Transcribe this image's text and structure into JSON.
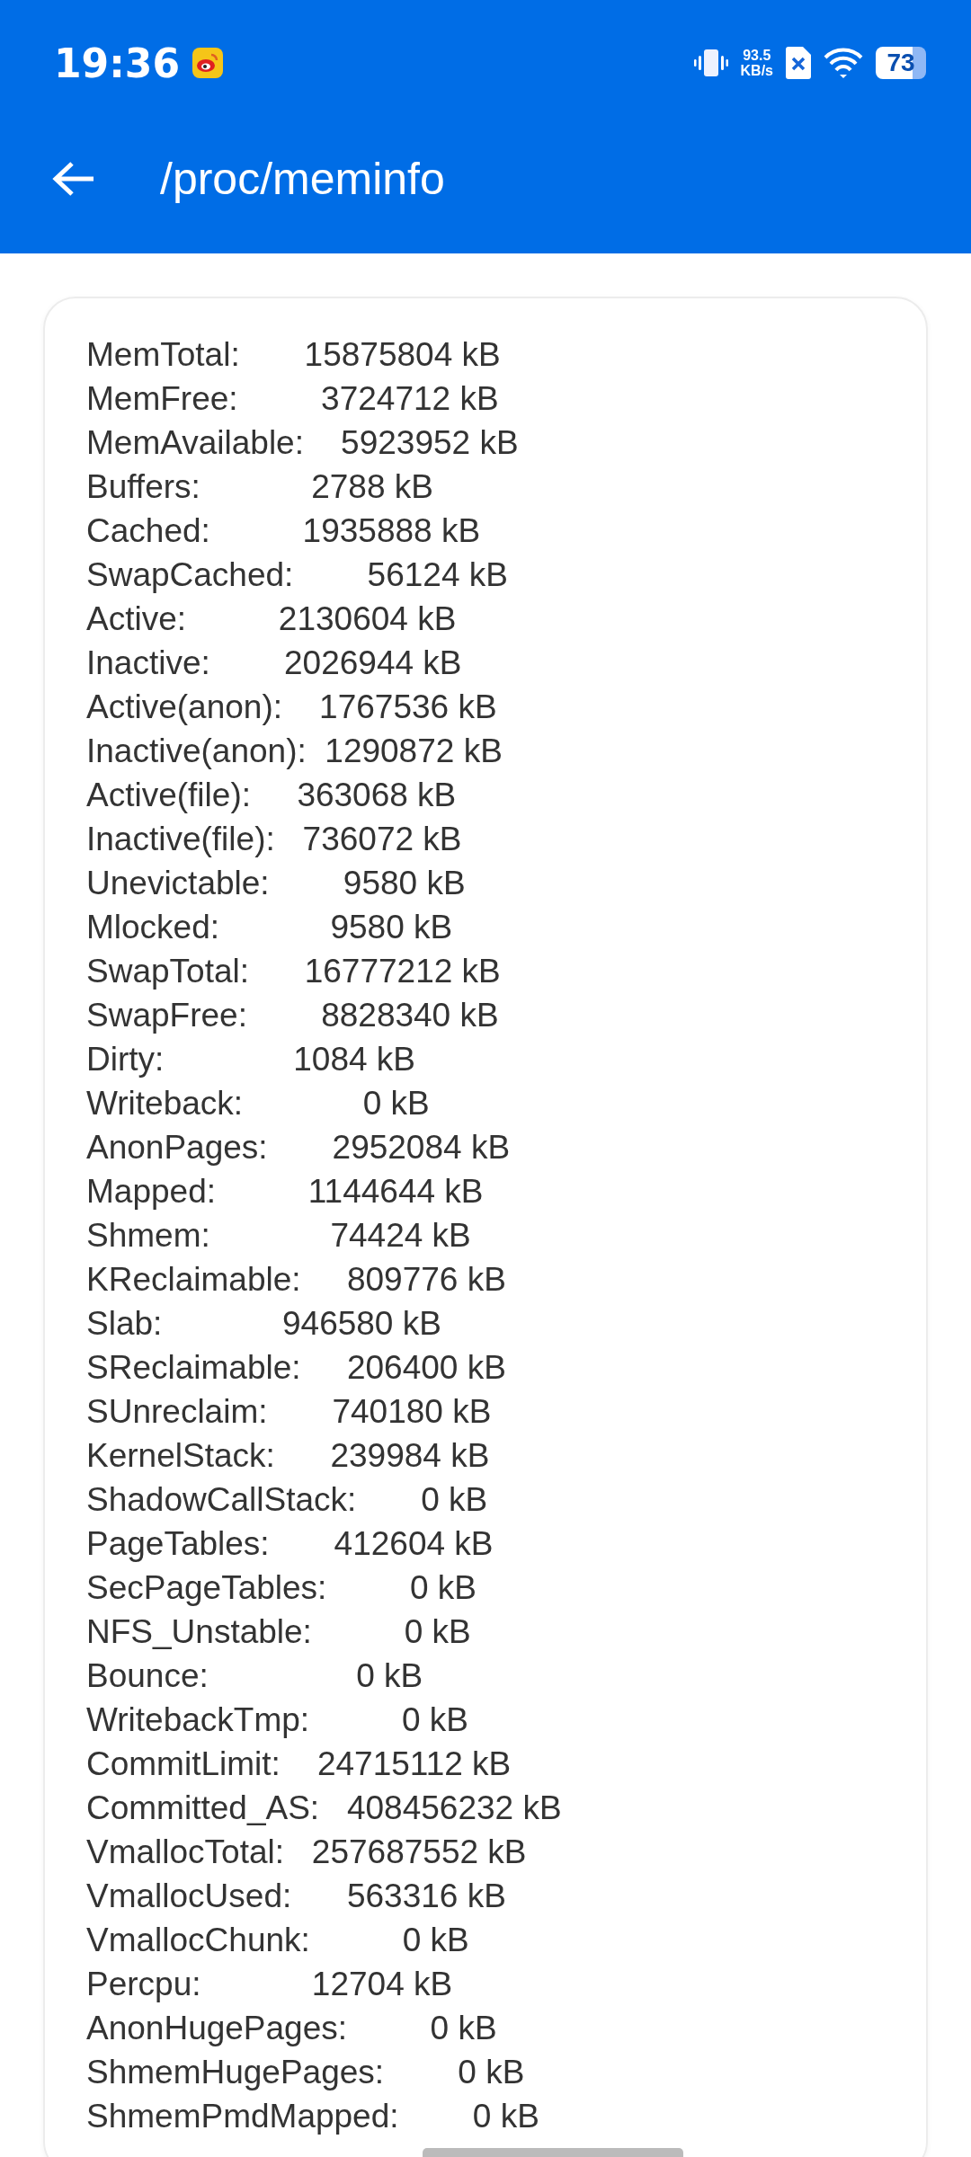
{
  "status_bar": {
    "time": "19:36",
    "net_speed": "93.5",
    "net_unit": "KB/s",
    "battery": "73"
  },
  "app_bar": {
    "title": "/proc/meminfo"
  },
  "lines": [
    "MemTotal:       15875804 kB",
    "MemFree:         3724712 kB",
    "MemAvailable:    5923952 kB",
    "Buffers:            2788 kB",
    "Cached:          1935888 kB",
    "SwapCached:        56124 kB",
    "Active:          2130604 kB",
    "Inactive:        2026944 kB",
    "Active(anon):    1767536 kB",
    "Inactive(anon):  1290872 kB",
    "Active(file):     363068 kB",
    "Inactive(file):   736072 kB",
    "Unevictable:        9580 kB",
    "Mlocked:            9580 kB",
    "SwapTotal:      16777212 kB",
    "SwapFree:        8828340 kB",
    "Dirty:              1084 kB",
    "Writeback:             0 kB",
    "AnonPages:       2952084 kB",
    "Mapped:          1144644 kB",
    "Shmem:             74424 kB",
    "KReclaimable:     809776 kB",
    "Slab:             946580 kB",
    "SReclaimable:     206400 kB",
    "SUnreclaim:       740180 kB",
    "KernelStack:      239984 kB",
    "ShadowCallStack:       0 kB",
    "PageTables:       412604 kB",
    "SecPageTables:         0 kB",
    "NFS_Unstable:          0 kB",
    "Bounce:                0 kB",
    "WritebackTmp:          0 kB",
    "CommitLimit:    24715112 kB",
    "Committed_AS:   408456232 kB",
    "VmallocTotal:   257687552 kB",
    "VmallocUsed:      563316 kB",
    "VmallocChunk:          0 kB",
    "Percpu:            12704 kB",
    "AnonHugePages:         0 kB",
    "ShmemHugePages:        0 kB",
    "ShmemPmdMapped:        0 kB"
  ]
}
